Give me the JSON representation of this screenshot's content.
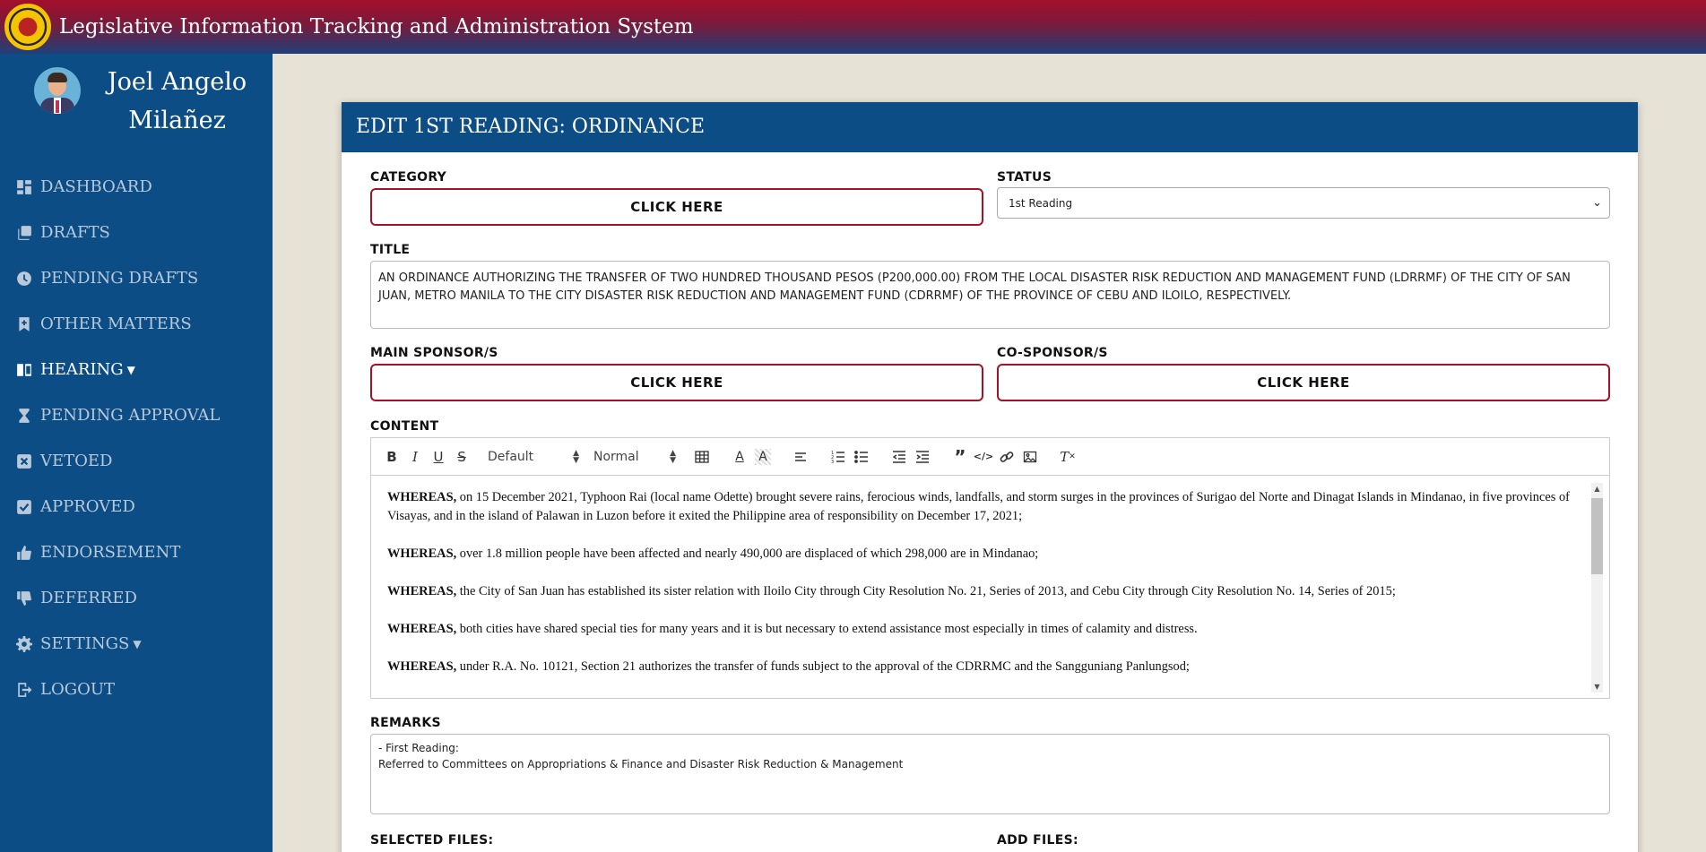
{
  "header": {
    "title": "Legislative Information Tracking and Administration System",
    "logo_icon": "city-seal-icon"
  },
  "user": {
    "name": "Joel Angelo Milañez",
    "avatar_icon": "user-avatar-icon"
  },
  "nav": {
    "dashboard": "DASHBOARD",
    "drafts": "DRAFTS",
    "pending_drafts": "PENDING DRAFTS",
    "other_matters": "OTHER MATTERS",
    "hearing": "HEARING",
    "pending_approval": "PENDING APPROVAL",
    "vetoed": "VETOED",
    "approved": "APPROVED",
    "endorsement": "ENDORSEMENT",
    "deferred": "DEFERRED",
    "settings": "SETTINGS",
    "logout": "LOGOUT"
  },
  "form": {
    "heading": "EDIT 1ST READING: ORDINANCE",
    "category_label": "CATEGORY",
    "category_button": "CLICK HERE",
    "status_label": "STATUS",
    "status_value": "1st Reading",
    "title_label": "TITLE",
    "title_value": "AN ORDINANCE AUTHORIZING THE TRANSFER OF TWO HUNDRED THOUSAND PESOS (P200,000.00) FROM THE LOCAL DISASTER RISK REDUCTION AND MANAGEMENT FUND (LDRRMF) OF THE CITY OF SAN JUAN, METRO MANILA TO THE CITY DISASTER RISK REDUCTION AND MANAGEMENT FUND (CDRRMF) OF THE PROVINCE OF CEBU AND ILOILO, RESPECTIVELY.",
    "main_sponsor_label": "MAIN SPONSOR/S",
    "main_sponsor_button": "CLICK HERE",
    "co_sponsor_label": "CO-SPONSOR/S",
    "co_sponsor_button": "CLICK HERE",
    "content_label": "CONTENT",
    "remarks_label": "REMARKS",
    "remarks_line1": "- First Reading:",
    "remarks_line2": "Referred to Committees on Appropriations & Finance and Disaster Risk Reduction & Management",
    "selected_files_label": "SELECTED FILES:",
    "add_files_label": "ADD FILES:"
  },
  "toolbar": {
    "font_value": "Default",
    "size_value": "Normal"
  },
  "content": {
    "lead": "WHEREAS,",
    "paragraphs": [
      "on 15 December 2021, Typhoon Rai (local name Odette) brought severe rains, ferocious winds, landfalls, and storm surges in the provinces of Surigao del Norte and Dinagat Islands in Mindanao, in five provinces of Visayas, and in the island of Palawan in Luzon before it exited the Philippine area of responsibility on December 17, 2021;",
      "over 1.8 million people have been affected and nearly 490,000 are displaced of which 298,000 are in Mindanao;",
      "the City of San Juan has established its sister relation with Iloilo City through City Resolution No. 21, Series of 2013, and Cebu City through City Resolution No. 14, Series of 2015;",
      "both cities have shared special ties for many years and it is but necessary to extend assistance most especially in times of calamity and distress.",
      "under R.A. No. 10121, Section 21 authorizes the transfer of funds subject to the approval of the CDRRMC and the Sangguniang Panlungsod;"
    ]
  },
  "colors": {
    "primary": "#0c4d86",
    "accent": "#a31226",
    "background": "#e6e2d5"
  }
}
